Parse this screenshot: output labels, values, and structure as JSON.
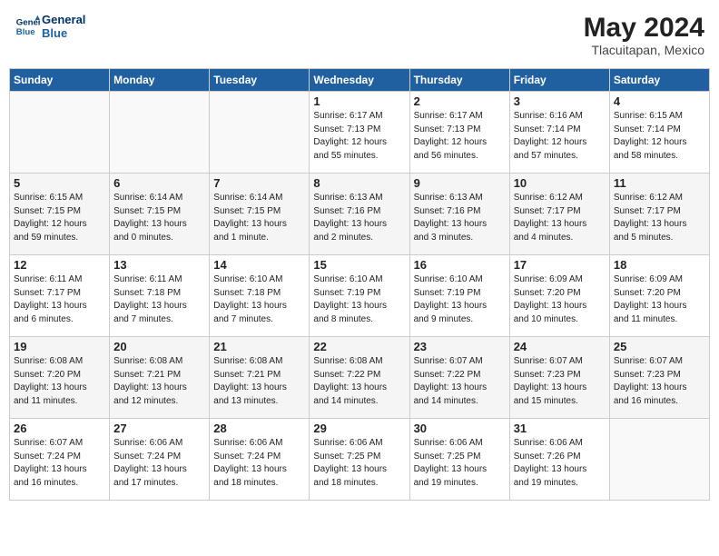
{
  "header": {
    "logo_line1": "General",
    "logo_line2": "Blue",
    "month_year": "May 2024",
    "location": "Tlacuitapan, Mexico"
  },
  "weekdays": [
    "Sunday",
    "Monday",
    "Tuesday",
    "Wednesday",
    "Thursday",
    "Friday",
    "Saturday"
  ],
  "weeks": [
    [
      {
        "day": "",
        "content": ""
      },
      {
        "day": "",
        "content": ""
      },
      {
        "day": "",
        "content": ""
      },
      {
        "day": "1",
        "content": "Sunrise: 6:17 AM\nSunset: 7:13 PM\nDaylight: 12 hours\nand 55 minutes."
      },
      {
        "day": "2",
        "content": "Sunrise: 6:17 AM\nSunset: 7:13 PM\nDaylight: 12 hours\nand 56 minutes."
      },
      {
        "day": "3",
        "content": "Sunrise: 6:16 AM\nSunset: 7:14 PM\nDaylight: 12 hours\nand 57 minutes."
      },
      {
        "day": "4",
        "content": "Sunrise: 6:15 AM\nSunset: 7:14 PM\nDaylight: 12 hours\nand 58 minutes."
      }
    ],
    [
      {
        "day": "5",
        "content": "Sunrise: 6:15 AM\nSunset: 7:15 PM\nDaylight: 12 hours\nand 59 minutes."
      },
      {
        "day": "6",
        "content": "Sunrise: 6:14 AM\nSunset: 7:15 PM\nDaylight: 13 hours\nand 0 minutes."
      },
      {
        "day": "7",
        "content": "Sunrise: 6:14 AM\nSunset: 7:15 PM\nDaylight: 13 hours\nand 1 minute."
      },
      {
        "day": "8",
        "content": "Sunrise: 6:13 AM\nSunset: 7:16 PM\nDaylight: 13 hours\nand 2 minutes."
      },
      {
        "day": "9",
        "content": "Sunrise: 6:13 AM\nSunset: 7:16 PM\nDaylight: 13 hours\nand 3 minutes."
      },
      {
        "day": "10",
        "content": "Sunrise: 6:12 AM\nSunset: 7:17 PM\nDaylight: 13 hours\nand 4 minutes."
      },
      {
        "day": "11",
        "content": "Sunrise: 6:12 AM\nSunset: 7:17 PM\nDaylight: 13 hours\nand 5 minutes."
      }
    ],
    [
      {
        "day": "12",
        "content": "Sunrise: 6:11 AM\nSunset: 7:17 PM\nDaylight: 13 hours\nand 6 minutes."
      },
      {
        "day": "13",
        "content": "Sunrise: 6:11 AM\nSunset: 7:18 PM\nDaylight: 13 hours\nand 7 minutes."
      },
      {
        "day": "14",
        "content": "Sunrise: 6:10 AM\nSunset: 7:18 PM\nDaylight: 13 hours\nand 7 minutes."
      },
      {
        "day": "15",
        "content": "Sunrise: 6:10 AM\nSunset: 7:19 PM\nDaylight: 13 hours\nand 8 minutes."
      },
      {
        "day": "16",
        "content": "Sunrise: 6:10 AM\nSunset: 7:19 PM\nDaylight: 13 hours\nand 9 minutes."
      },
      {
        "day": "17",
        "content": "Sunrise: 6:09 AM\nSunset: 7:20 PM\nDaylight: 13 hours\nand 10 minutes."
      },
      {
        "day": "18",
        "content": "Sunrise: 6:09 AM\nSunset: 7:20 PM\nDaylight: 13 hours\nand 11 minutes."
      }
    ],
    [
      {
        "day": "19",
        "content": "Sunrise: 6:08 AM\nSunset: 7:20 PM\nDaylight: 13 hours\nand 11 minutes."
      },
      {
        "day": "20",
        "content": "Sunrise: 6:08 AM\nSunset: 7:21 PM\nDaylight: 13 hours\nand 12 minutes."
      },
      {
        "day": "21",
        "content": "Sunrise: 6:08 AM\nSunset: 7:21 PM\nDaylight: 13 hours\nand 13 minutes."
      },
      {
        "day": "22",
        "content": "Sunrise: 6:08 AM\nSunset: 7:22 PM\nDaylight: 13 hours\nand 14 minutes."
      },
      {
        "day": "23",
        "content": "Sunrise: 6:07 AM\nSunset: 7:22 PM\nDaylight: 13 hours\nand 14 minutes."
      },
      {
        "day": "24",
        "content": "Sunrise: 6:07 AM\nSunset: 7:23 PM\nDaylight: 13 hours\nand 15 minutes."
      },
      {
        "day": "25",
        "content": "Sunrise: 6:07 AM\nSunset: 7:23 PM\nDaylight: 13 hours\nand 16 minutes."
      }
    ],
    [
      {
        "day": "26",
        "content": "Sunrise: 6:07 AM\nSunset: 7:24 PM\nDaylight: 13 hours\nand 16 minutes."
      },
      {
        "day": "27",
        "content": "Sunrise: 6:06 AM\nSunset: 7:24 PM\nDaylight: 13 hours\nand 17 minutes."
      },
      {
        "day": "28",
        "content": "Sunrise: 6:06 AM\nSunset: 7:24 PM\nDaylight: 13 hours\nand 18 minutes."
      },
      {
        "day": "29",
        "content": "Sunrise: 6:06 AM\nSunset: 7:25 PM\nDaylight: 13 hours\nand 18 minutes."
      },
      {
        "day": "30",
        "content": "Sunrise: 6:06 AM\nSunset: 7:25 PM\nDaylight: 13 hours\nand 19 minutes."
      },
      {
        "day": "31",
        "content": "Sunrise: 6:06 AM\nSunset: 7:26 PM\nDaylight: 13 hours\nand 19 minutes."
      },
      {
        "day": "",
        "content": ""
      }
    ]
  ]
}
